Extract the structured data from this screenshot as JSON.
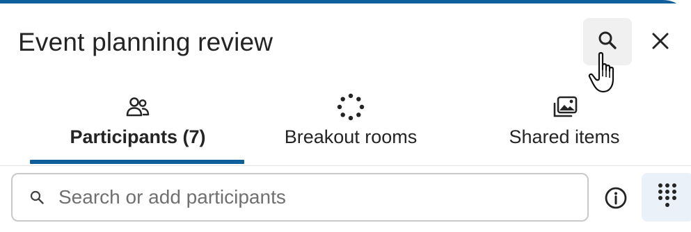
{
  "header": {
    "title": "Event planning review",
    "search_icon": "search-icon",
    "close_icon": "close-icon"
  },
  "tabs": [
    {
      "label": "Participants (7)",
      "icon": "people-icon",
      "active": true
    },
    {
      "label": "Breakout rooms",
      "icon": "breakout-rooms-icon",
      "active": false
    },
    {
      "label": "Shared items",
      "icon": "shared-items-icon",
      "active": false
    }
  ],
  "search": {
    "placeholder": "Search or add participants",
    "value": ""
  },
  "actions": {
    "info_icon": "info-icon",
    "dialpad_icon": "dialpad-icon"
  },
  "colors": {
    "accent": "#0f5f9a",
    "text": "#242424",
    "placeholder": "#707070",
    "hover_bg": "#f0f0f0",
    "dialpad_bg": "#ebf1f8"
  }
}
